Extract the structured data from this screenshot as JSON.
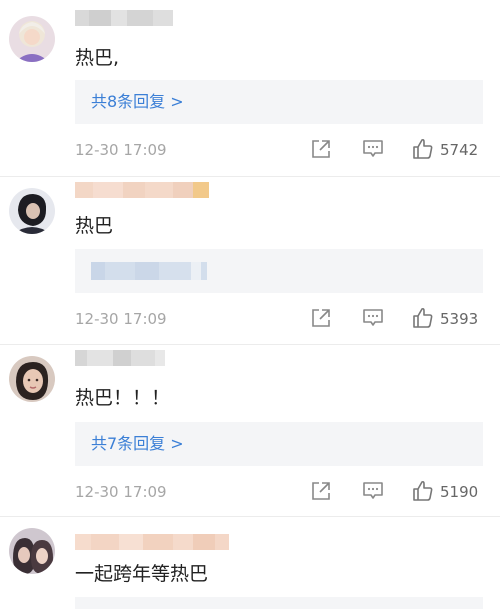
{
  "comments": [
    {
      "content": "热巴,",
      "reply_summary": "共8条回复 >",
      "timestamp": "12-30 17:09",
      "likes": "5742"
    },
    {
      "content": "热巴",
      "timestamp": "12-30 17:09",
      "likes": "5393"
    },
    {
      "content": "热巴！！！",
      "reply_summary": "共7条回复 >",
      "timestamp": "12-30 17:09",
      "likes": "5190"
    },
    {
      "content": "一起跨年等热巴"
    }
  ],
  "icons": {
    "share": "share-icon",
    "comment": "comment-icon",
    "like": "thumbs-up-icon"
  },
  "colors": {
    "link": "#3b7fd6",
    "timestamp": "#a6a6a6",
    "reply_background": "#f4f5f7"
  }
}
